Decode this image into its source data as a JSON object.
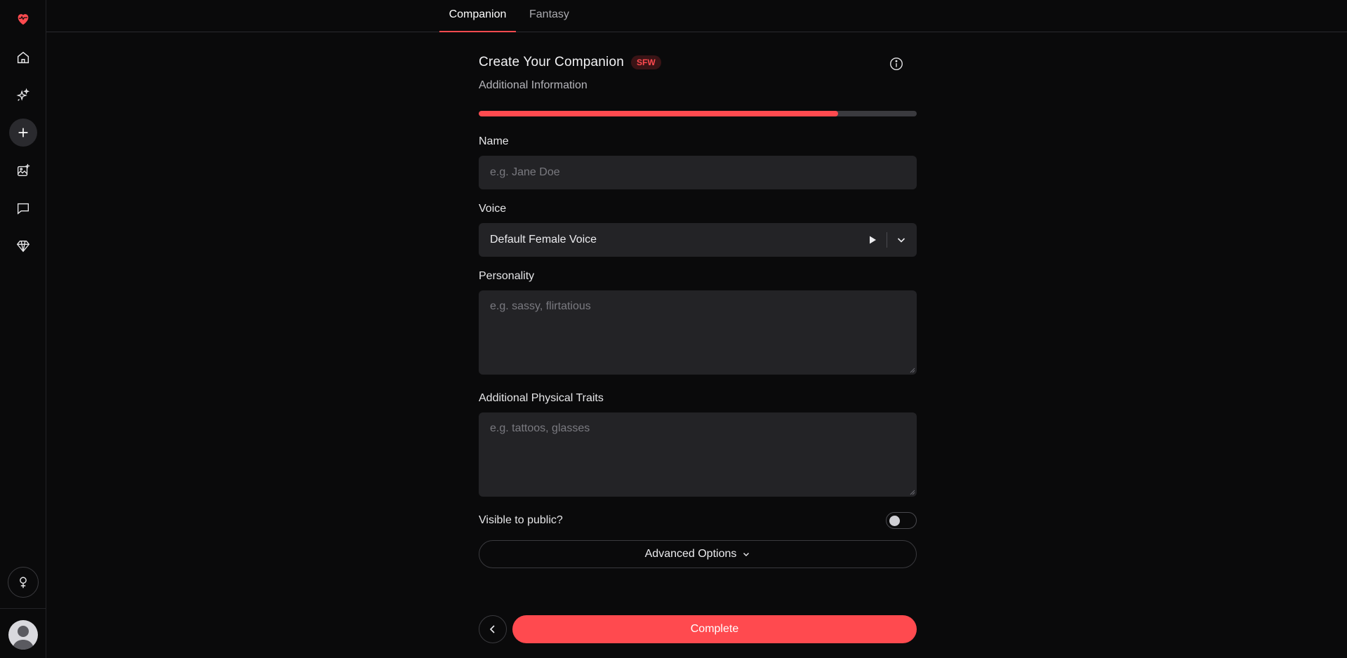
{
  "tabs": [
    {
      "label": "Companion",
      "active": true
    },
    {
      "label": "Fantasy",
      "active": false
    }
  ],
  "sidebar": {
    "items": [
      {
        "icon": "heart-pulse-logo-icon"
      },
      {
        "icon": "home-icon"
      },
      {
        "icon": "sparkles-icon"
      },
      {
        "icon": "plus-icon",
        "active": true
      },
      {
        "icon": "image-add-icon"
      },
      {
        "icon": "chat-icon"
      },
      {
        "icon": "diamond-icon"
      }
    ],
    "gender_icon": "female-symbol-icon",
    "avatar_icon": "user-avatar-icon"
  },
  "header": {
    "title": "Create Your Companion",
    "badge": "SFW",
    "subtitle": "Additional Information",
    "progress": 0.82
  },
  "form": {
    "name": {
      "label": "Name",
      "placeholder": "e.g. Jane Doe",
      "value": ""
    },
    "voice": {
      "label": "Voice",
      "value": "Default Female Voice"
    },
    "personality": {
      "label": "Personality",
      "placeholder": "e.g. sassy, flirtatious",
      "value": ""
    },
    "traits": {
      "label": "Additional Physical Traits",
      "placeholder": "e.g. tattoos, glasses",
      "value": ""
    },
    "visible": {
      "label": "Visible to public?",
      "on": false
    },
    "advanced_label": "Advanced Options",
    "complete_label": "Complete"
  },
  "colors": {
    "accent": "#ff4a4f",
    "background": "#0a0a0b",
    "field": "#232326"
  }
}
